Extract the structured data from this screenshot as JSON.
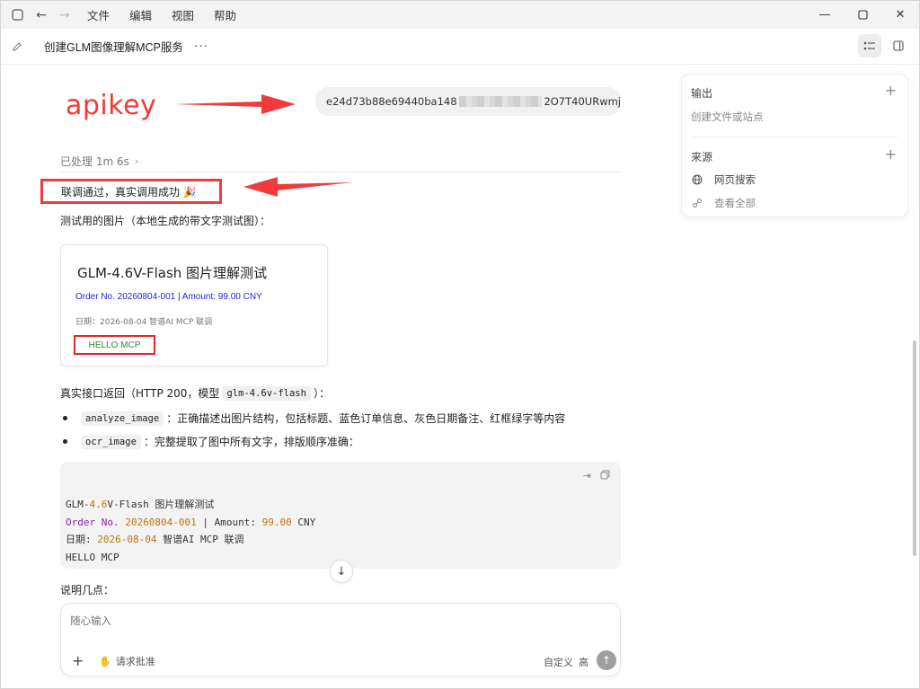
{
  "titlebar": {
    "menu": [
      "文件",
      "编辑",
      "视图",
      "帮助"
    ]
  },
  "header": {
    "title": "创建GLM图像理解MCP服务",
    "more": "···"
  },
  "annotation": {
    "apikey_label": "apikey",
    "arrow_color": "#ef3b3b"
  },
  "chat": {
    "key_prefix": "e24d73b88e69440ba148",
    "key_suffix": "2O7T40URwmj",
    "processed": "已处理 1m 6s",
    "result": "联调通过，真实调用成功 🎉",
    "caption": "测试用的图片（本地生成的带文字测试图）：",
    "card": {
      "title": "GLM-4.6V-Flash 图片理解测试",
      "order": "Order No. 20260804-001 | Amount: 99.00 CNY",
      "date": "日期：2026-08-04   智谱AI MCP 联调",
      "hello": "HELLO MCP"
    },
    "return_prefix": "真实接口返回（HTTP 200，模型",
    "return_model": "glm-4.6v-flash",
    "return_suffix": "）：",
    "bullets": [
      {
        "code": "analyze_image",
        "text": "：正确描述出图片结构，包括标题、蓝色订单信息、灰色日期备注、红框绿字等内容"
      },
      {
        "code": "ocr_image",
        "text": "：完整提取了图中所有文字，排版顺序准确："
      }
    ],
    "code_lines": {
      "l1_a": "GLM-",
      "l1_b": "4.6",
      "l1_c": "V-Flash 图片理解测试",
      "l2_a": "Order No.",
      "l2_b": " ",
      "l2_c": "20260804-001",
      "l2_d": " | Amount: ",
      "l2_e": "99.00",
      "l2_f": " CNY",
      "l3_a": "日期: ",
      "l3_b": "2026-08-04",
      "l3_c": "  智谱AI MCP 联调",
      "l4": "HELLO MCP"
    },
    "explain": "说明几点："
  },
  "composer": {
    "placeholder": "随心输入",
    "approve": "请求批准",
    "custom": "自定义",
    "level": "高"
  },
  "panel": {
    "output_title": "输出",
    "output_sub": "创建文件或站点",
    "source_title": "来源",
    "web_search": "网页搜索",
    "view_all": "查看全部"
  }
}
